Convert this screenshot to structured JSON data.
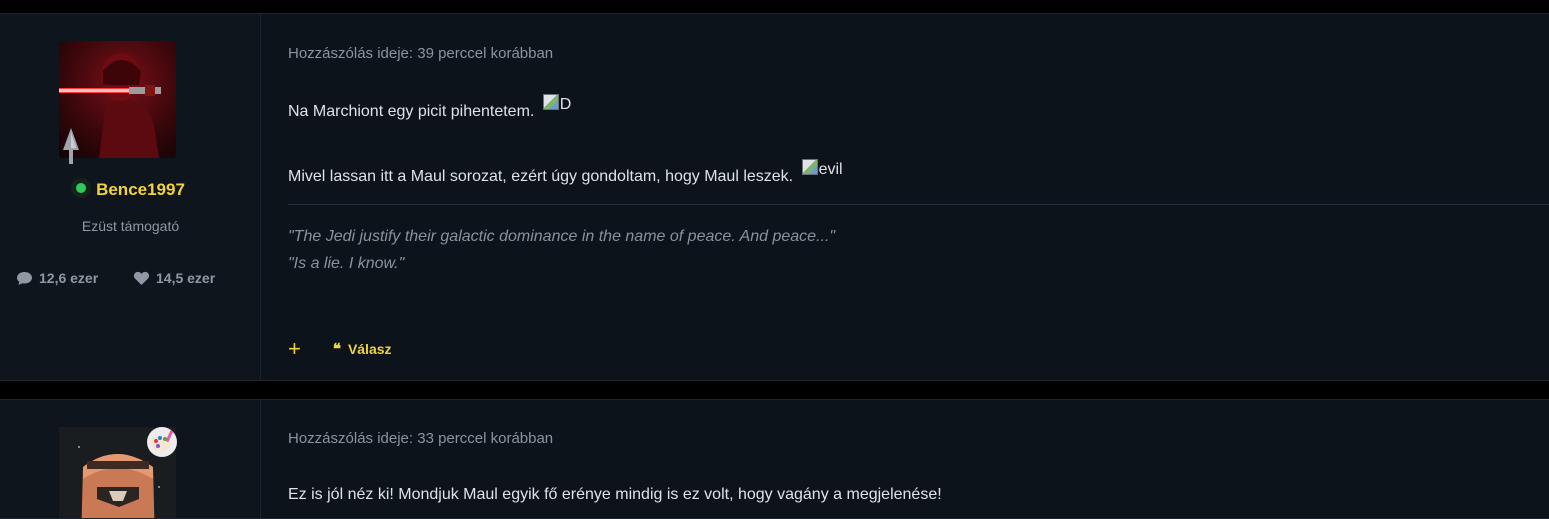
{
  "posts": [
    {
      "author": {
        "username": "Bence1997",
        "title": "Ezüst támogató",
        "online": true,
        "posts_count": "12,6 ezer",
        "likes_count": "14,5 ezer"
      },
      "meta": "Hozzászólás ideje: 39 perccel korábban",
      "paragraphs": [
        {
          "text": "Na Marchiont egy picit pihentetem.",
          "emote_alt": "D"
        },
        {
          "text": "Mivel lassan itt a Maul sorozat, ezért úgy gondoltam, hogy Maul leszek.",
          "emote_alt": "evil"
        }
      ],
      "signature": [
        "\"The Jedi justify their galactic dominance in the name of peace. And peace...\"",
        "\"Is a lie. I know.\""
      ],
      "actions": {
        "plus": "+",
        "reply_icon": "❝",
        "reply": "Válasz"
      }
    },
    {
      "meta": "Hozzászólás ideje: 33 perccel korábban",
      "paragraphs": [
        {
          "text": "Ez is jól néz ki! Mondjuk Maul egyik fő erénye mindig is ez volt, hogy vagány a megjelenése!"
        }
      ]
    }
  ],
  "icons": {
    "comment": "comment-icon",
    "heart": "heart-icon",
    "rank": "spearhead-rank-icon"
  },
  "colors": {
    "accent": "#f3d33b",
    "online": "#2ecc57",
    "background": "#0c131b"
  }
}
